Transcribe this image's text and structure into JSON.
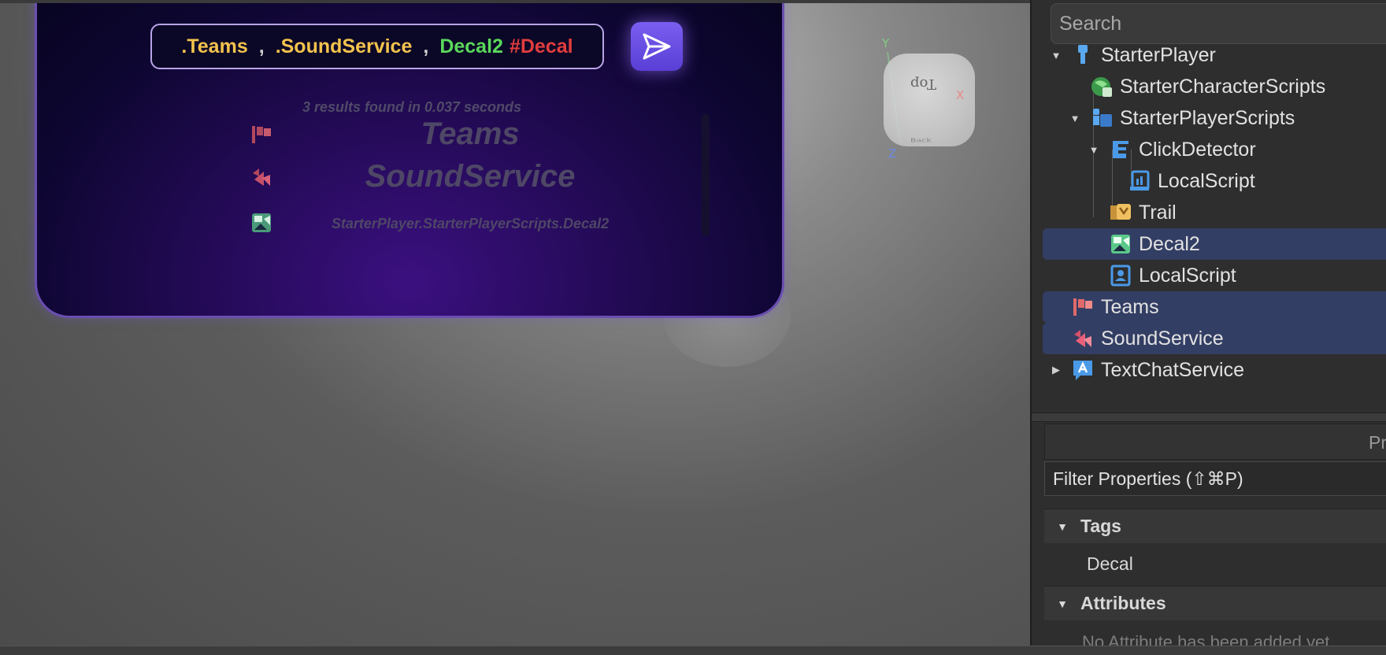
{
  "search_panel": {
    "query": {
      "token1": ".Teams",
      "sep1": ",",
      "token2": ".SoundService",
      "sep2": ",",
      "token3": "Decal2",
      "token4": "#Decal"
    },
    "result_info": "3 results found in 0.037 seconds",
    "results": [
      {
        "icon": "teams-flag-icon",
        "label": "Teams"
      },
      {
        "icon": "sound-service-icon",
        "label": "SoundService"
      },
      {
        "icon": "decal-icon",
        "label": "StarterPlayer.StarterPlayerScripts.Decal2"
      }
    ]
  },
  "viewcube": {
    "top_label": "Top",
    "back_label": "Back",
    "axis_x": "X",
    "axis_y": "Y",
    "axis_z": "Z"
  },
  "explorer": {
    "search_placeholder": "Search",
    "items": [
      {
        "label": "StarterPlayer",
        "icon": "starter-player-icon",
        "expanded": true
      },
      {
        "label": "StarterCharacterScripts",
        "icon": "starter-character-scripts-icon"
      },
      {
        "label": "StarterPlayerScripts",
        "icon": "starter-player-scripts-icon",
        "expanded": true
      },
      {
        "label": "ClickDetector",
        "icon": "click-detector-icon",
        "expanded": true
      },
      {
        "label": "LocalScript",
        "icon": "local-script-icon"
      },
      {
        "label": "Trail",
        "icon": "trail-icon"
      },
      {
        "label": "Decal2",
        "icon": "decal-icon",
        "selected": true
      },
      {
        "label": "LocalScript",
        "icon": "local-script-icon"
      },
      {
        "label": "Teams",
        "icon": "teams-flag-icon",
        "selected": true
      },
      {
        "label": "SoundService",
        "icon": "sound-service-icon",
        "selected": true
      },
      {
        "label": "TextChatService",
        "icon": "text-chat-service-icon",
        "expanded": false
      }
    ]
  },
  "properties": {
    "header": "Pr",
    "filter": "Filter Properties (⇧⌘P)",
    "sections": [
      {
        "title": "Tags",
        "rows": [
          "Decal"
        ]
      },
      {
        "title": "Attributes",
        "empty_text": "No Attribute has been added yet"
      }
    ]
  },
  "colors": {
    "accent_purple": "#6a4fb0",
    "selection": "#333e64",
    "token_yellow": "#f3c34d",
    "token_green": "#5ad85a",
    "token_red": "#e33d3d"
  }
}
